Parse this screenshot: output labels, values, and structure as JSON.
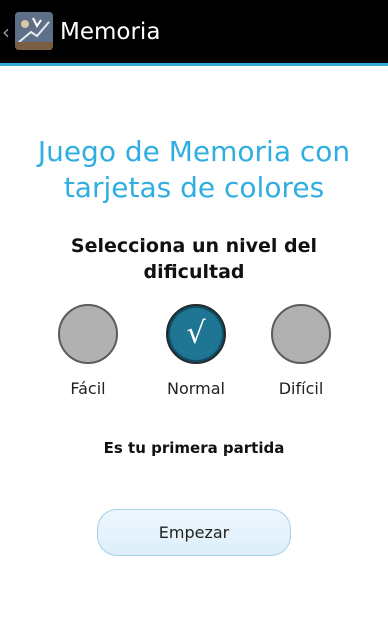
{
  "action_bar": {
    "title": "Memoria",
    "up_glyph": "‹",
    "icon": "app-logo-icon",
    "background_color": "#000000",
    "divider_color": "#35a8d8"
  },
  "main": {
    "game_title_line1": "Juego de Memoria con",
    "game_title_line2": "tarjetas de colores",
    "title_color": "#31aee0",
    "difficulty_line1": "Selecciona un nivel del",
    "difficulty_line2": "dificultad",
    "difficulty_options": [
      {
        "label": "Fácil",
        "selected": false
      },
      {
        "label": "Normal",
        "selected": true
      },
      {
        "label": "Difícil",
        "selected": false
      }
    ],
    "selected_color": "#1e7594",
    "check_glyph": "√",
    "status": "Es tu primera partida",
    "start_button_label": "Empezar"
  }
}
